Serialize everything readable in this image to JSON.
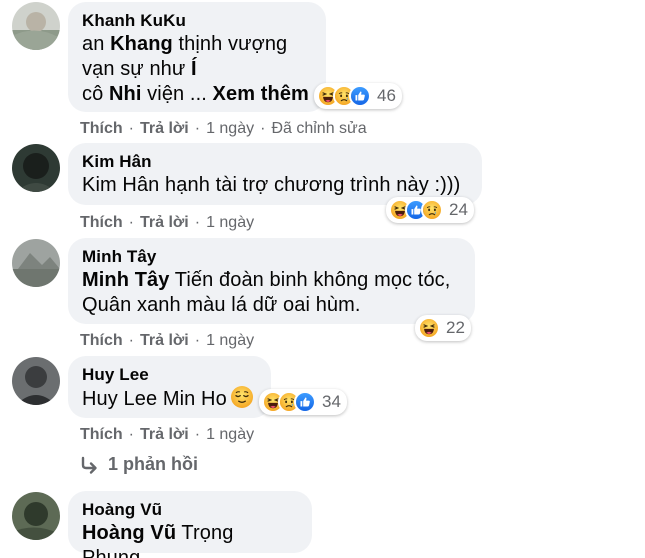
{
  "comments": [
    {
      "author": "Khanh KuKu",
      "lines": [
        "an ",
        "Khang",
        " thịnh vượng",
        "vạn sự như ",
        "Í",
        "cô ",
        "Nhi",
        " viện ... ",
        "Xem thêm"
      ],
      "reaction_count": "46",
      "actions": {
        "like": "Thích",
        "reply": "Trả lời",
        "time": "1 ngày",
        "edited": "Đã chỉnh sửa"
      }
    },
    {
      "author": "Kim Hân",
      "text": "Kim Hân hạnh tài trợ chương trình này :)))",
      "reaction_count": "24",
      "actions": {
        "like": "Thích",
        "reply": "Trả lời",
        "time": "1 ngày"
      }
    },
    {
      "author": "Minh Tây",
      "tag": "Minh Tây",
      "line1_rest": " Tiến đoàn binh không mọc tóc,",
      "line2": "Quân xanh màu lá dữ oai hùm.",
      "reaction_count": "22",
      "actions": {
        "like": "Thích",
        "reply": "Trả lời",
        "time": "1 ngày"
      }
    },
    {
      "author": "Huy Lee",
      "text": "Huy Lee Min Ho",
      "reaction_count": "34",
      "actions": {
        "like": "Thích",
        "reply": "Trả lời",
        "time": "1 ngày"
      },
      "replies_label": "1 phản hồi"
    },
    {
      "author": "Hoàng Vũ",
      "tag": "Hoàng Vũ",
      "rest": " Trọng Phụng"
    }
  ],
  "icons": {
    "haha": "haha-icon",
    "sad": "sad-icon",
    "like": "like-icon",
    "relieved": "relieved-face-icon",
    "reply_arrow": "reply-arrow-icon"
  },
  "colors": {
    "bubble": "#f0f2f5",
    "meta": "#65676b",
    "like_blue": "#1877f2",
    "emoji_yellow": "#f7b125"
  }
}
